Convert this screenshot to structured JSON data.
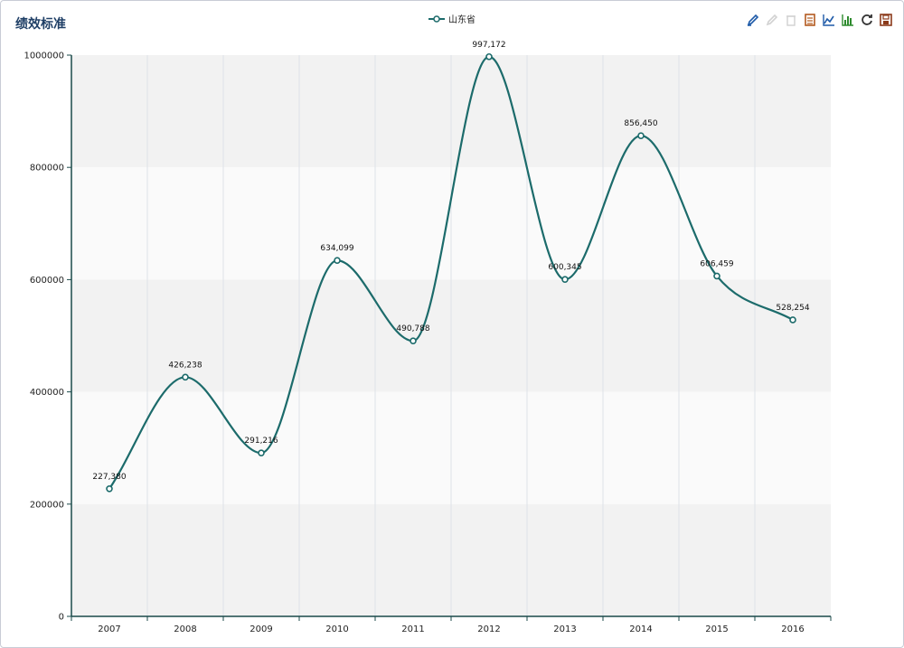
{
  "chart_data": {
    "type": "line",
    "title": "绩效标准",
    "categories": [
      "2007",
      "2008",
      "2009",
      "2010",
      "2011",
      "2012",
      "2013",
      "2014",
      "2015",
      "2016"
    ],
    "series": [
      {
        "name": "山东省",
        "values": [
          227380,
          426238,
          291216,
          634099,
          490788,
          997172,
          600345,
          856450,
          606459,
          528254
        ],
        "labels": [
          "227,380",
          "426,238",
          "291,216",
          "634,099",
          "490,788",
          "997,172",
          "600,345",
          "856,450",
          "606,459",
          "528,254"
        ],
        "color": "#1c6b6b",
        "smooth": true
      }
    ],
    "ylim": [
      0,
      1000000
    ],
    "yticks": [
      "0",
      "200000",
      "400000",
      "600000",
      "800000",
      "1000000"
    ],
    "grid": true,
    "legend_position": "top-center",
    "band_colors": [
      "#f2f2f2",
      "#fafafa"
    ]
  },
  "toolbox": {
    "items": [
      {
        "name": "mark-pen-icon",
        "color": "#1e5aa8",
        "enabled": true
      },
      {
        "name": "mark-eraser-icon",
        "color": "#9a9a9a",
        "enabled": false
      },
      {
        "name": "clear-mark-icon",
        "color": "#9a9a9a",
        "enabled": false
      },
      {
        "name": "data-view-icon",
        "color": "#b35a1f",
        "enabled": true
      },
      {
        "name": "line-chart-icon",
        "color": "#1e5aa8",
        "enabled": true
      },
      {
        "name": "bar-chart-icon",
        "color": "#2e8b2e",
        "enabled": true
      },
      {
        "name": "refresh-icon",
        "color": "#333333",
        "enabled": true
      },
      {
        "name": "save-image-icon",
        "color": "#8b3a1a",
        "enabled": true
      }
    ]
  }
}
